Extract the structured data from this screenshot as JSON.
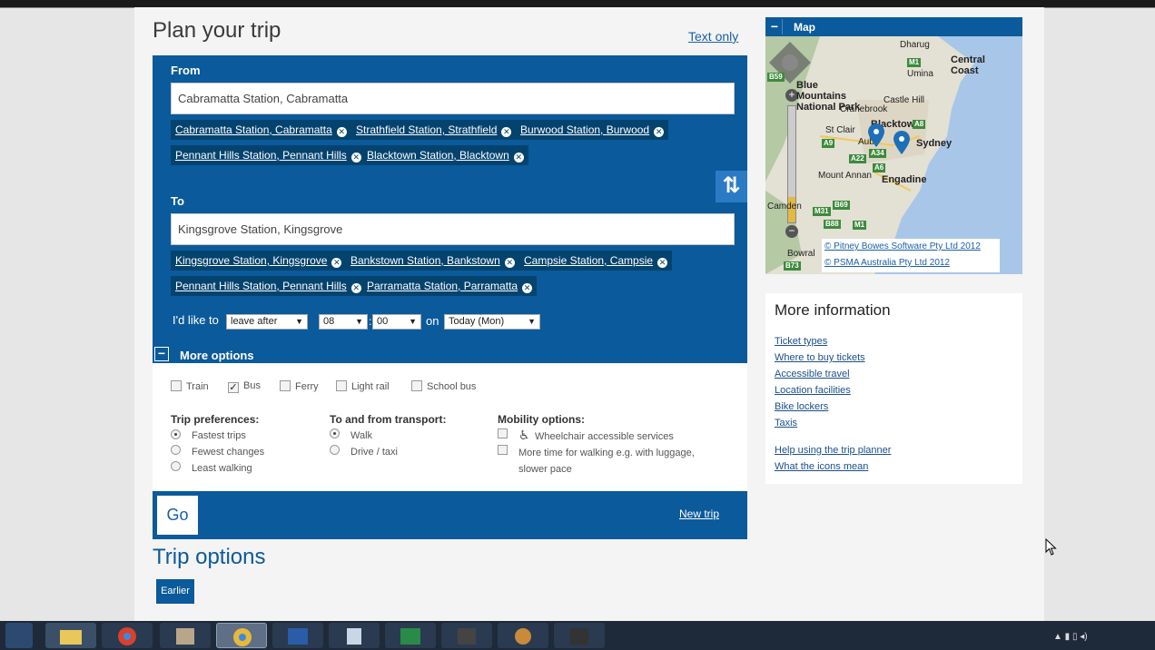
{
  "page": {
    "title": "Plan your trip",
    "text_only": "Text only"
  },
  "from": {
    "label": "From",
    "value": "Cabramatta Station, Cabramatta",
    "recent": [
      "Cabramatta Station, Cabramatta",
      "Strathfield Station, Strathfield",
      "Burwood Station, Burwood",
      "Pennant Hills Station, Pennant Hills",
      "Blacktown Station, Blacktown"
    ]
  },
  "to": {
    "label": "To",
    "value": "Kingsgrove Station, Kingsgrove",
    "recent": [
      "Kingsgrove Station, Kingsgrove",
      "Bankstown Station, Bankstown",
      "Campsie Station, Campsie",
      "Pennant Hills Station, Pennant Hills",
      "Parramatta Station, Parramatta"
    ]
  },
  "when": {
    "label": "I'd like to",
    "mode": "leave after",
    "hour": "08",
    "minute": "00",
    "on_label": "on",
    "day": "Today (Mon)"
  },
  "more_options": {
    "label": "More options",
    "modes": [
      {
        "label": "Train",
        "checked": false
      },
      {
        "label": "Bus",
        "checked": true
      },
      {
        "label": "Ferry",
        "checked": false
      },
      {
        "label": "Light rail",
        "checked": false
      },
      {
        "label": "School bus",
        "checked": false
      }
    ],
    "preferences": {
      "heading": "Trip preferences:",
      "items": [
        "Fastest trips",
        "Fewest changes",
        "Least walking"
      ],
      "selected": 0
    },
    "transport": {
      "heading": "To and from transport:",
      "items": [
        "Walk",
        "Drive / taxi"
      ],
      "selected": 0
    },
    "mobility": {
      "heading": "Mobility options:",
      "items": [
        "Wheelchair accessible services",
        "More time for walking e.g. with luggage,",
        "slower pace"
      ]
    }
  },
  "actions": {
    "go": "Go",
    "new_trip": "New trip"
  },
  "trip_options": {
    "title": "Trip options",
    "earlier": "Earlier"
  },
  "map": {
    "title": "Map",
    "labels": {
      "central_coast": "Central Coast",
      "blue_mountains": "Blue Mountains National Park",
      "blacktown": "Blacktown",
      "sydney": "Sydney",
      "engadine": "Engadine",
      "bowral": "Bowral",
      "dharug": "Dharug",
      "umina": "Umina",
      "castle_hill": "Castle Hill",
      "cranebrook": "Cranebrook",
      "st_clair": "St Clair",
      "mount_annan": "Mount Annan",
      "camden": "Camden",
      "auburn": "Aub"
    },
    "roads": [
      "M1",
      "B59",
      "A8",
      "A9",
      "A22",
      "A34",
      "A6",
      "M31",
      "B69",
      "B88",
      "M1",
      "B73"
    ],
    "copyright": [
      "© Pitney Bowes Software Pty Ltd 2012",
      "© PSMA Australia Pty Ltd 2012"
    ]
  },
  "info": {
    "title": "More information",
    "links": [
      "Ticket types",
      "Where to buy tickets",
      "Accessible travel",
      "Location facilities",
      "Bike lockers",
      "Taxis"
    ],
    "links2": [
      "Help using the trip planner",
      "What the icons mean"
    ]
  },
  "colors": {
    "primary": "#0b5a9b",
    "chip": "#05436f",
    "link": "#1a5fa8"
  }
}
